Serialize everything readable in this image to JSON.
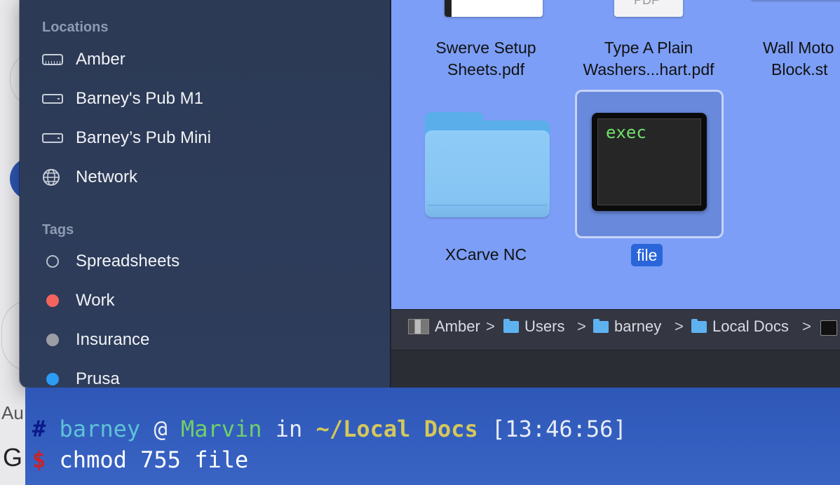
{
  "background": {
    "partial_text_1": "Au",
    "partial_text_2": "G"
  },
  "sidebar": {
    "locations_title": "Locations",
    "locations": [
      {
        "label": "Amber",
        "icon": "external-drive-icon"
      },
      {
        "label": "Barney's Pub M1",
        "icon": "drive-icon"
      },
      {
        "label": "Barney’s Pub Mini",
        "icon": "drive-icon"
      },
      {
        "label": "Network",
        "icon": "globe-icon"
      }
    ],
    "tags_title": "Tags",
    "tags": [
      {
        "label": "Spreadsheets",
        "color": "none"
      },
      {
        "label": "Work",
        "color": "#f4645f"
      },
      {
        "label": "Insurance",
        "color": "#9b9ea6"
      },
      {
        "label": "Prusa",
        "color": "#2d9cf4"
      }
    ]
  },
  "files": [
    {
      "label_line1": "Swerve Setup",
      "label_line2": "Sheets.pdf"
    },
    {
      "label_line1": "Type A Plain",
      "label_line2": "Washers...hart.pdf",
      "thumb_text": "PDF"
    },
    {
      "label_line1": "Wall Moto",
      "label_line2": "Block.st"
    },
    {
      "label_line1": "XCarve NC",
      "type": "folder"
    },
    {
      "label_line1": "file",
      "type": "exec",
      "thumb_text": "exec",
      "selected": true
    }
  ],
  "pathbar": {
    "items": [
      "Amber",
      "Users",
      "barney",
      "Local Docs"
    ],
    "separator": ">"
  },
  "terminal": {
    "prompt_hash": "#",
    "user": "barney",
    "at": "@",
    "host": "Marvin",
    "in": "in",
    "cwd": "~/Local Docs",
    "time": "[13:46:56]",
    "prompt_dollar": "$",
    "command": "chmod 755 file",
    "colors": {
      "hash": "#0a1a8a",
      "user": "#5ec3d6",
      "host": "#6fd06a",
      "cwd": "#d4c85a",
      "time": "#e8ecf5",
      "dollar": "#c8232c",
      "text": "#ffffff"
    }
  },
  "colors": {
    "finder_content": "#7c9ef6",
    "sidebar": "#2c3a55",
    "selection": "#2a66d9"
  }
}
